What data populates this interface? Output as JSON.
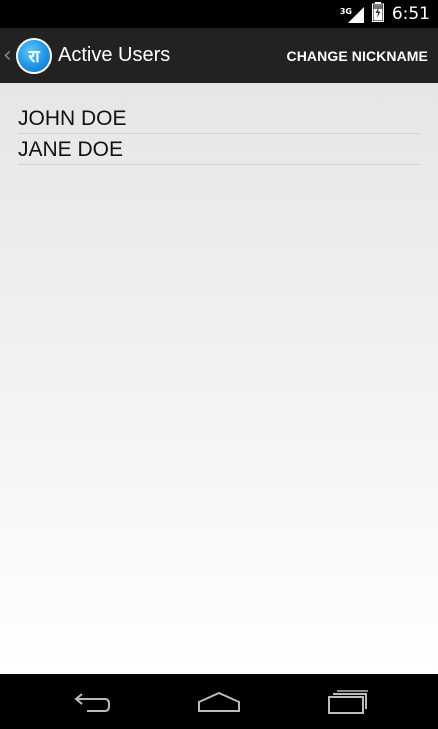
{
  "status_bar": {
    "network_type": "3G",
    "time": "6:51",
    "icons": [
      "signal-icon",
      "battery-icon"
    ]
  },
  "action_bar": {
    "up_icon": "chevron-left-icon",
    "app_icon_glyph": "रा",
    "title": "Active Users",
    "action_label": "CHANGE NICKNAME"
  },
  "users": [
    {
      "name": "JOHN DOE"
    },
    {
      "name": "JANE DOE"
    }
  ],
  "nav_bar": {
    "icons": [
      "back-icon",
      "home-icon",
      "recent-apps-icon"
    ]
  },
  "colors": {
    "action_bar_bg": "#222222",
    "app_icon_blue": "#1a8fe0",
    "text_dark": "#111111"
  }
}
